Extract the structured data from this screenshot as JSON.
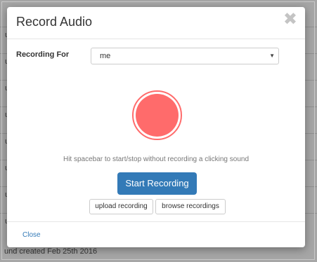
{
  "background": {
    "row_fragments": [
      "u",
      "u",
      "u",
      "u",
      "u",
      "u",
      "u",
      "u"
    ],
    "footer_text": "und created Feb 25th 2016"
  },
  "modal": {
    "title": "Record Audio",
    "close_glyph": "✖",
    "recording_for_label": "Recording For",
    "recording_for_value": "me",
    "select_caret": "▼",
    "record_button_color": "#ff6b6b",
    "hint": "Hit spacebar to start/stop without recording a clicking sound",
    "start_button_label": "Start Recording",
    "upload_button_label": "upload recording",
    "browse_button_label": "browse recordings",
    "close_link_label": "Close",
    "accent_color": "#337ab7"
  }
}
